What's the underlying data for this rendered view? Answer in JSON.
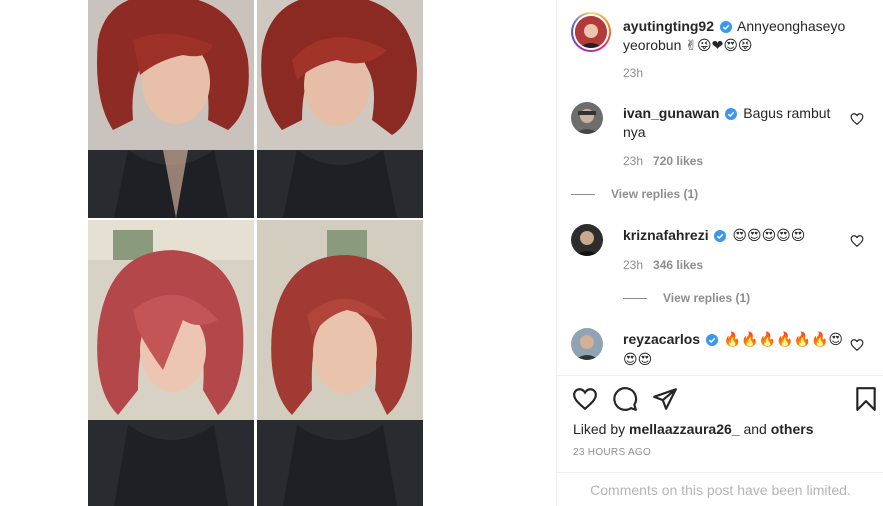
{
  "post": {
    "author": "ayutingting92",
    "caption": "Annyeonghaseyo yeorobun",
    "caption_emojis": "✌😜❤😍😝",
    "time": "23h"
  },
  "comments": [
    {
      "user": "ivan_gunawan",
      "text": "Bagus rambut nya",
      "time": "23h",
      "likes": "720 likes",
      "replies": "View replies (1)"
    },
    {
      "user": "kriznafahrezi",
      "text": "😍😍😍😍😍",
      "time": "23h",
      "likes": "346 likes",
      "replies": "View replies (1)"
    },
    {
      "user": "reyzacarlos",
      "text": "🔥🔥🔥🔥🔥🔥😍😍😍"
    }
  ],
  "footer": {
    "liked_prefix": "Liked by",
    "liked_user": "mellaazzaura26_",
    "liked_and": "and",
    "liked_others": "others",
    "posted_ago": "23 HOURS AGO",
    "limited_notice": "Comments on this post have been limited."
  },
  "icons": [
    "verified-badge-icon",
    "heart-icon",
    "comment-icon",
    "share-icon",
    "bookmark-icon"
  ],
  "colors": {
    "verified": "#3897f0",
    "muted": "#8e8e8e",
    "text": "#262626"
  }
}
